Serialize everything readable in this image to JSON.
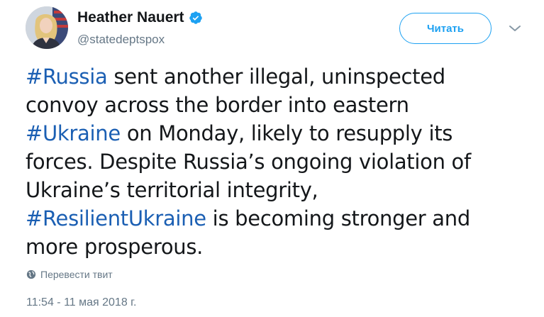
{
  "author": {
    "display_name": "Heather Nauert",
    "handle": "@statedeptspox",
    "verified_icon": "verified-badge-icon"
  },
  "follow_button": {
    "label": "Читать"
  },
  "menu": {
    "caret_icon": "chevron-down-icon"
  },
  "tweet": {
    "lines": [
      [
        {
          "text": "#Russia",
          "tag": true
        },
        {
          "text": " sent another illegal, uninspected",
          "tag": false
        }
      ],
      [
        {
          "text": "convoy across the border into eastern",
          "tag": false
        }
      ],
      [
        {
          "text": "#Ukraine",
          "tag": true
        },
        {
          "text": " on Monday, likely to resupply its",
          "tag": false
        }
      ],
      [
        {
          "text": "forces.  Despite Russia’s ongoing violation of",
          "tag": false
        }
      ],
      [
        {
          "text": "Ukraine’s territorial integrity,",
          "tag": false
        }
      ],
      [
        {
          "text": "#ResilientUkraine",
          "tag": true
        },
        {
          "text": " is becoming stronger and",
          "tag": false
        }
      ],
      [
        {
          "text": "more prosperous.",
          "tag": false
        }
      ]
    ],
    "translate_label": "Перевести твит",
    "timestamp": "11:54 - 11 мая 2018 г."
  },
  "colors": {
    "hashtag": "#1b5fb3",
    "follow_blue": "#1da1f2",
    "verified_blue": "#1da1f2",
    "muted": "#657786",
    "text": "#14171a"
  }
}
